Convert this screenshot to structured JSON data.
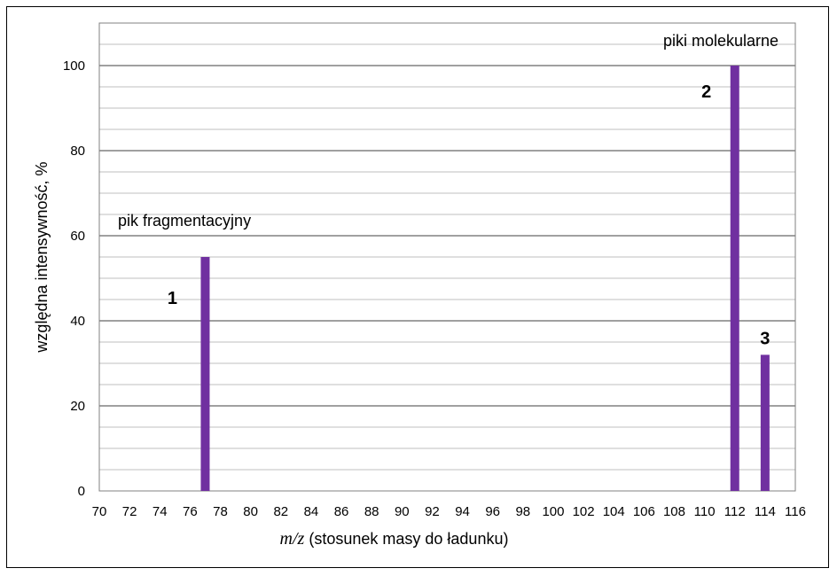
{
  "chart_data": {
    "type": "bar",
    "ylabel": "względna intensywność, %",
    "xlabel_italic": "m/z",
    "xlabel_rest": "(stosunek masy do ładunku)",
    "xlim": [
      70,
      116
    ],
    "ylim": [
      0,
      110
    ],
    "x_ticks": [
      70,
      72,
      74,
      76,
      78,
      80,
      82,
      84,
      86,
      88,
      90,
      92,
      94,
      96,
      98,
      100,
      102,
      104,
      106,
      108,
      110,
      112,
      114,
      116
    ],
    "y_ticks": [
      0,
      20,
      40,
      60,
      80,
      100
    ],
    "minor_grid_step": 5,
    "bars": [
      {
        "x": 77,
        "value": 55,
        "number": "1"
      },
      {
        "x": 112,
        "value": 100,
        "number": "2"
      },
      {
        "x": 114,
        "value": 32,
        "number": "3"
      }
    ],
    "annotations": {
      "fragment": "pik fragmentacyjny",
      "molecular": "piki molekularne"
    },
    "bar_color": "#7030a0",
    "grid": true
  }
}
